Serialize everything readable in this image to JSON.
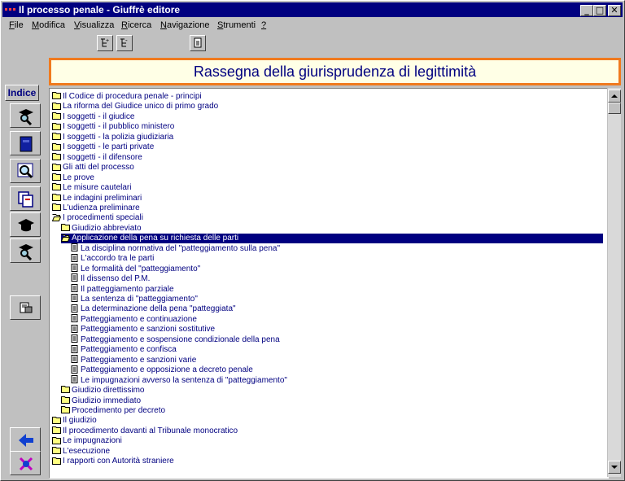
{
  "window": {
    "title": "Il processo penale - Giuffrè editore"
  },
  "menu": [
    {
      "label": "File",
      "u": "F",
      "rest": "ile"
    },
    {
      "label": "Modifica",
      "u": "M",
      "rest": "odifica"
    },
    {
      "label": "Visualizza",
      "u": "V",
      "rest": "isualizza"
    },
    {
      "label": "Ricerca",
      "u": "R",
      "rest": "icerca"
    },
    {
      "label": "Navigazione",
      "u": "N",
      "rest": "avigazione"
    },
    {
      "label": "Strumenti",
      "u": "S",
      "rest": "trumenti"
    },
    {
      "label": "?",
      "u": "?",
      "rest": ""
    }
  ],
  "banner": {
    "title": "Rassegna della giurisprudenza di legittimità"
  },
  "sidebar": {
    "indice_label": "Indice"
  },
  "tree": [
    {
      "label": "Il Codice di procedura penale - principi",
      "level": 0,
      "icon": "folder-closed"
    },
    {
      "label": "La riforma del Giudice unico di primo grado",
      "level": 0,
      "icon": "folder-closed"
    },
    {
      "label": "I soggetti - il giudice",
      "level": 0,
      "icon": "folder-closed"
    },
    {
      "label": "I soggetti - il pubblico ministero",
      "level": 0,
      "icon": "folder-closed"
    },
    {
      "label": "I soggetti - la polizia giudiziaria",
      "level": 0,
      "icon": "folder-closed"
    },
    {
      "label": "I soggetti - le parti private",
      "level": 0,
      "icon": "folder-closed"
    },
    {
      "label": "I soggetti - il difensore",
      "level": 0,
      "icon": "folder-closed"
    },
    {
      "label": "Gli atti del processo",
      "level": 0,
      "icon": "folder-closed"
    },
    {
      "label": "Le prove",
      "level": 0,
      "icon": "folder-closed"
    },
    {
      "label": "Le misure cautelari",
      "level": 0,
      "icon": "folder-closed"
    },
    {
      "label": "Le indagini preliminari",
      "level": 0,
      "icon": "folder-closed"
    },
    {
      "label": "L'udienza preliminare",
      "level": 0,
      "icon": "folder-closed"
    },
    {
      "label": "I procedimenti speciali",
      "level": 0,
      "icon": "folder-open"
    },
    {
      "label": "Giudizio abbreviato",
      "level": 1,
      "icon": "folder-closed"
    },
    {
      "label": "Applicazione della pena su richiesta delle parti",
      "level": 1,
      "icon": "folder-open",
      "selected": true
    },
    {
      "label": "La disciplina normativa del \"patteggiamento sulla pena\"",
      "level": 2,
      "icon": "document"
    },
    {
      "label": "L'accordo tra le parti",
      "level": 2,
      "icon": "document"
    },
    {
      "label": "Le formalità del \"patteggiamento\"",
      "level": 2,
      "icon": "document"
    },
    {
      "label": "Il dissenso del P.M.",
      "level": 2,
      "icon": "document"
    },
    {
      "label": "Il patteggiamento parziale",
      "level": 2,
      "icon": "document"
    },
    {
      "label": "La sentenza di \"patteggiamento\"",
      "level": 2,
      "icon": "document"
    },
    {
      "label": "La determinazione della pena \"patteggiata\"",
      "level": 2,
      "icon": "document"
    },
    {
      "label": "Patteggiamento e continuazione",
      "level": 2,
      "icon": "document"
    },
    {
      "label": "Patteggiamento e sanzioni sostitutive",
      "level": 2,
      "icon": "document"
    },
    {
      "label": "Patteggiamento e sospensione condizionale della pena",
      "level": 2,
      "icon": "document"
    },
    {
      "label": "Patteggiamento e confisca",
      "level": 2,
      "icon": "document"
    },
    {
      "label": "Patteggiamento e sanzioni varie",
      "level": 2,
      "icon": "document"
    },
    {
      "label": "Patteggiamento e opposizione a decreto penale",
      "level": 2,
      "icon": "document"
    },
    {
      "label": "Le impugnazioni avverso la sentenza di \"patteggiamento\"",
      "level": 2,
      "icon": "document"
    },
    {
      "label": "Giudizio direttissimo",
      "level": 1,
      "icon": "folder-closed"
    },
    {
      "label": "Giudizio immediato",
      "level": 1,
      "icon": "folder-closed"
    },
    {
      "label": "Procedimento per decreto",
      "level": 1,
      "icon": "folder-closed"
    },
    {
      "label": "Il giudizio",
      "level": 0,
      "icon": "folder-closed"
    },
    {
      "label": "Il procedimento davanti al Tribunale monocratico",
      "level": 0,
      "icon": "folder-closed"
    },
    {
      "label": "Le impugnazioni",
      "level": 0,
      "icon": "folder-closed"
    },
    {
      "label": "L'esecuzione",
      "level": 0,
      "icon": "folder-closed"
    },
    {
      "label": "I rapporti con Autorità straniere",
      "level": 0,
      "icon": "folder-closed"
    }
  ],
  "colors": {
    "titlebar": "#000080",
    "banner_border": "#f07a1e",
    "banner_bg": "#ffffe6",
    "tree_text": "#000080",
    "selection": "#000080"
  }
}
